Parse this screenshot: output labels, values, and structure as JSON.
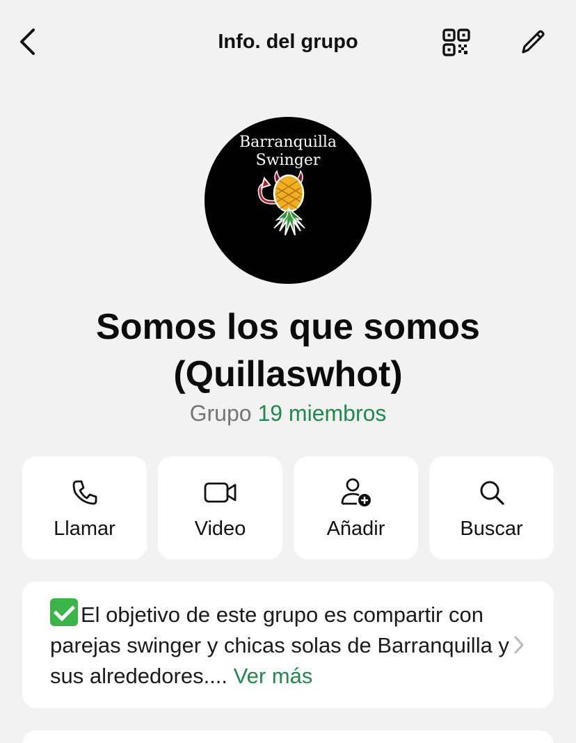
{
  "header": {
    "title": "Info. del grupo",
    "back_icon": "chevron-left-icon",
    "qr_icon": "qr-code-icon",
    "edit_icon": "pencil-icon"
  },
  "avatar": {
    "line1": "Barranquilla",
    "line2": "Swinger"
  },
  "group": {
    "name": "Somos los que somos (Quillaswhot)",
    "type_label": "Grupo",
    "members_label": "19 miembros"
  },
  "actions": [
    {
      "label": "Llamar",
      "icon": "phone-icon"
    },
    {
      "label": "Video",
      "icon": "video-camera-icon"
    },
    {
      "label": "Añadir",
      "icon": "add-person-icon"
    },
    {
      "label": "Buscar",
      "icon": "search-icon"
    }
  ],
  "description": {
    "text": "El objetivo de este grupo es compartir con parejas swinger y chicas solas de Barranquilla y sus alrededores....",
    "more_label": "Ver más",
    "emoji_icon": "check-mark-emoji-icon"
  },
  "colors": {
    "background": "#f2f2f2",
    "card": "#ffffff",
    "accent_green": "#1f8a4c",
    "muted_text": "#757575"
  }
}
